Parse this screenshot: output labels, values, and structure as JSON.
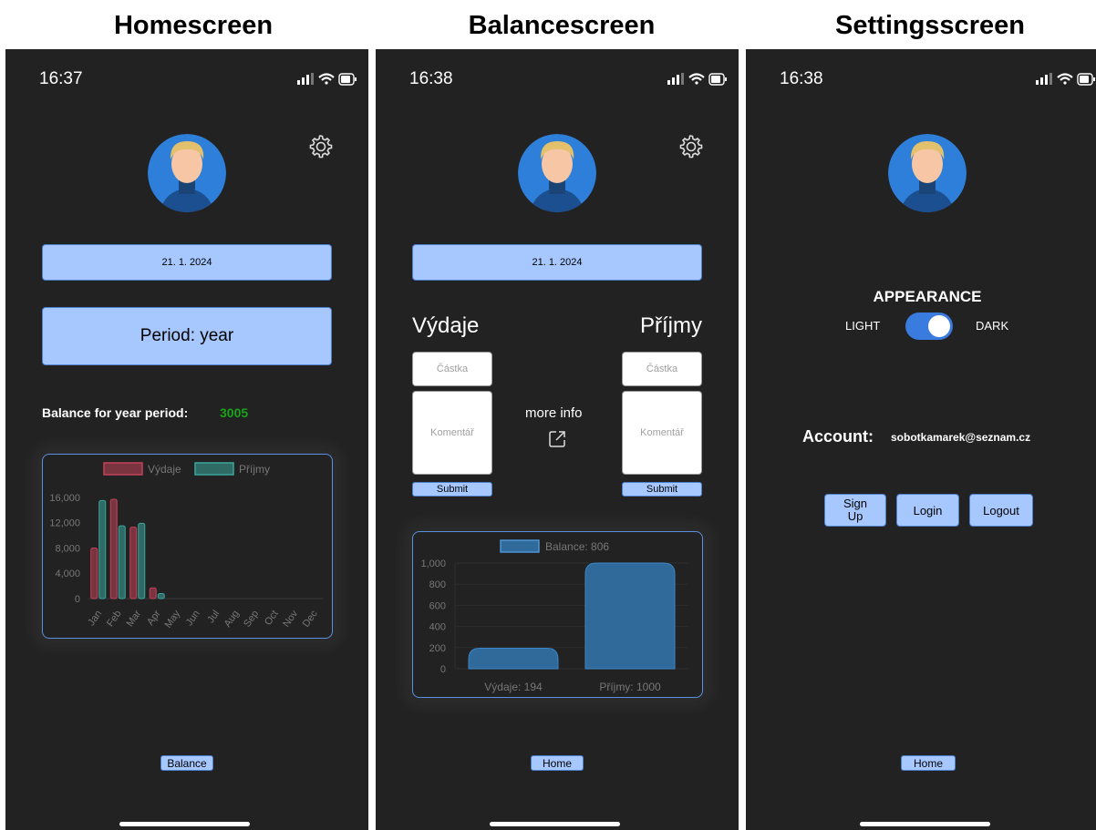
{
  "captions": [
    "Homescreen",
    "Balancescreen",
    "Settingsscreen"
  ],
  "home": {
    "time": "16:37",
    "date_button": "21. 1. 2024",
    "period_button": "Period: year",
    "balance_label": "Balance for year period:",
    "balance_value": "3005",
    "nav_button": "Balance",
    "chart_data": {
      "type": "bar",
      "categories": [
        "Jan",
        "Feb",
        "Mar",
        "Apr",
        "May",
        "Jun",
        "Jul",
        "Aug",
        "Sep",
        "Oct",
        "Nov",
        "Dec"
      ],
      "series": [
        {
          "name": "Výdaje",
          "color": "#c2435a",
          "values": [
            8000,
            15700,
            11300,
            1700,
            0,
            0,
            0,
            0,
            0,
            0,
            0,
            0
          ]
        },
        {
          "name": "Příjmy",
          "color": "#3aa69d",
          "values": [
            15500,
            11500,
            11900,
            800,
            0,
            0,
            0,
            0,
            0,
            0,
            0,
            0
          ]
        }
      ],
      "yticks": [
        "16,000",
        "12,000",
        "8,000",
        "4,000",
        "0"
      ],
      "ylim": [
        0,
        17000
      ]
    }
  },
  "balance": {
    "time": "16:38",
    "date_button": "21. 1. 2024",
    "expenses_title": "Výdaje",
    "income_title": "Příjmy",
    "amount_placeholder": "Částka",
    "comment_placeholder": "Komentář",
    "submit_label": "Submit",
    "more_info": "more info",
    "nav_button": "Home",
    "chart_data": {
      "type": "bar",
      "categories": [
        "Výdaje: 194",
        "Příjmy: 1000"
      ],
      "values": [
        194,
        1000
      ],
      "legend": "Balance: 806",
      "yticks": [
        "1,000",
        "800",
        "600",
        "400",
        "200",
        "0"
      ],
      "ylim": [
        0,
        1000
      ],
      "color": "#2f6a9a"
    }
  },
  "settings": {
    "time": "16:38",
    "appearance_title": "APPEARANCE",
    "light_label": "LIGHT",
    "dark_label": "DARK",
    "account_label": "Account:",
    "account_email": "sobotkamarek@seznam.cz",
    "signup_label": "Sign Up",
    "login_label": "Login",
    "logout_label": "Logout",
    "nav_button": "Home"
  }
}
